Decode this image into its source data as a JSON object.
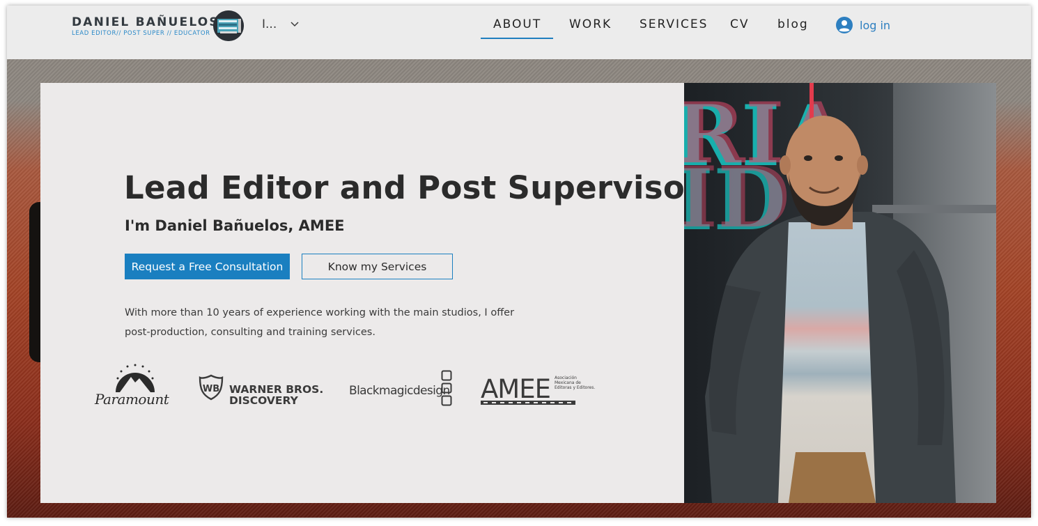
{
  "header": {
    "brand_name": "DANIEL  BAÑUELOS",
    "brand_tagline": "LEAD EDITOR// POST SUPER // EDUCATOR",
    "language": "I...",
    "nav": [
      {
        "label": "ABOUT",
        "active": true
      },
      {
        "label": "WORK",
        "active": false
      },
      {
        "label": "SERVICES",
        "active": false
      },
      {
        "label": "CV",
        "active": false
      },
      {
        "label": "blog",
        "active": false
      }
    ],
    "login_label": "log in"
  },
  "hero": {
    "title": "Lead Editor and Post Supervisor",
    "subtitle": "I'm Daniel Bañuelos, AMEE",
    "primary_button": "Request a Free Consultation",
    "secondary_button": "Know my Services",
    "description": "With more than 10 years of experience working with the main studios, I offer post-production, consulting and training services."
  },
  "partners": {
    "paramount": "Paramount",
    "warner_line1": "WARNER BROS.",
    "warner_line2": "DISCOVERY",
    "blackmagic": "Blackmagicdesign",
    "amee": "AMEE",
    "amee_full": "Asociación Mexicana de Editoras y Editores."
  },
  "colors": {
    "accent": "#1a7fc0",
    "header_bg": "#ececec",
    "card_bg": "#eceaea"
  }
}
